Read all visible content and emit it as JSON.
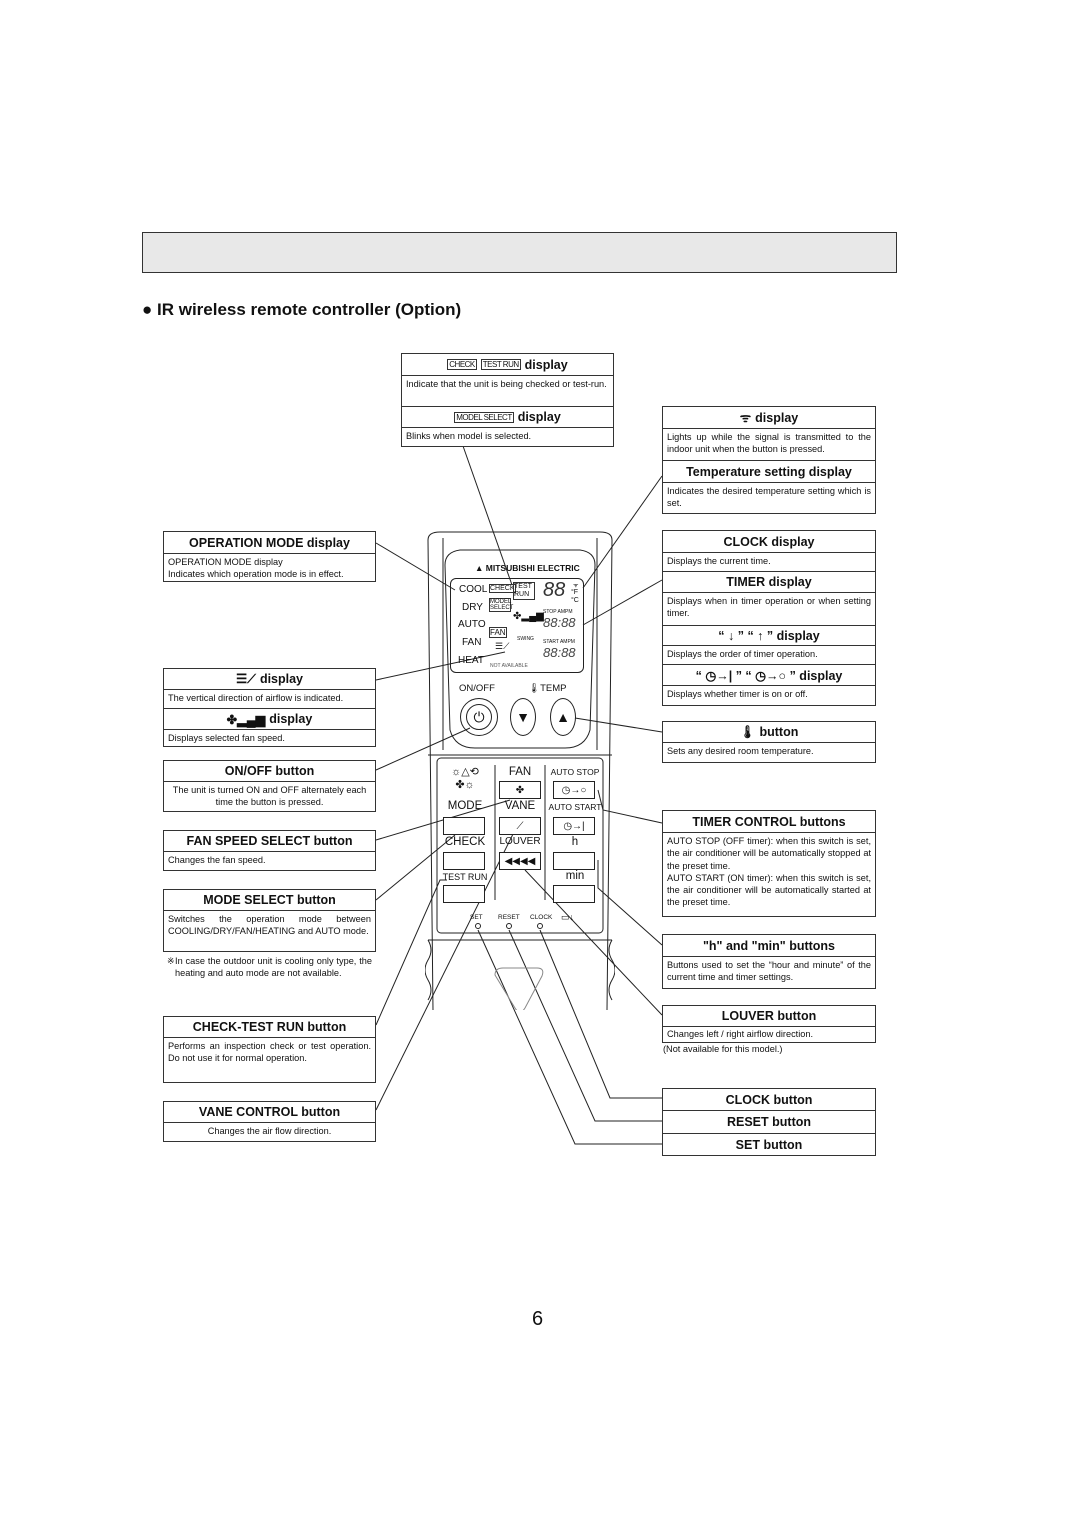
{
  "page": {
    "title": "● IR wireless remote controller (Option)",
    "page_number": "6"
  },
  "callouts": {
    "check_display": {
      "tag1": "CHECK",
      "tag2": "TEST RUN",
      "title": "display",
      "desc": "Indicate that the unit is being checked or test-run."
    },
    "model_select_display": {
      "tag": "MODEL SELECT",
      "title": "display",
      "desc": "Blinks when model is selected."
    },
    "signal_display": {
      "icon": "signal-icon",
      "title": "display",
      "desc": "Lights up while the signal is transmitted to the indoor unit when the button is pressed."
    },
    "temp_setting_display": {
      "title": "Temperature setting display",
      "desc": "Indicates the desired temperature setting which is set."
    },
    "operation_mode_display": {
      "title": "OPERATION MODE display",
      "desc1": "OPERATION MODE display",
      "desc2": "Indicates which operation mode is in effect."
    },
    "vane_display": {
      "icon": "vane-airflow-icon",
      "title": "display",
      "desc": "The vertical direction of airflow is indicated."
    },
    "fan_speed_display": {
      "icon": "fan-speed-icon",
      "title": "display",
      "desc": "Displays selected fan speed."
    },
    "onoff_button": {
      "title": "ON/OFF button",
      "desc": "The unit is turned ON and OFF alternately each time the button is pressed."
    },
    "fan_speed_button": {
      "title": "FAN SPEED SELECT button",
      "desc": "Changes the fan speed."
    },
    "mode_select_button": {
      "title": "MODE SELECT button",
      "desc": "Switches the operation mode between COOLING/DRY/FAN/HEATING and AUTO mode.",
      "note": "※In case the outdoor unit is cooling only type, the heating and auto mode are not available."
    },
    "check_test_run_button": {
      "title": "CHECK-TEST RUN button",
      "desc": "Performs an inspection  check or test operation. Do not use it for normal operation."
    },
    "vane_control_button": {
      "title": "VANE CONTROL button",
      "desc": "Changes the air flow direction."
    },
    "clock_display": {
      "title": "CLOCK display",
      "desc": "Displays the current time."
    },
    "timer_display": {
      "title": "TIMER display",
      "desc": "Displays when in timer operation or when setting timer."
    },
    "order_display": {
      "title": "“ ↓ ” “ ↑ ” display",
      "desc": "Displays the order of timer operation."
    },
    "timer_onoff_display": {
      "title": "“ ◷→| ” “ ◷→○ ” display",
      "desc": "Displays whether timer is on or off."
    },
    "temp_button": {
      "icon": "thermometer-icon",
      "title": "button",
      "desc": "Sets any desired room temperature."
    },
    "timer_control_buttons": {
      "title": "TIMER CONTROL buttons",
      "desc1": "AUTO STOP (OFF timer):  when this switch is set, the air conditioner will be automatically stopped at the preset time.",
      "desc2": "AUTO START (ON timer): when this switch is set, the air conditioner will be automatically started at the preset time."
    },
    "h_min_buttons": {
      "title": "\"h\" and \"min\" buttons",
      "desc": "Buttons used to set the “hour and minute” of the current time and timer settings."
    },
    "louver_button": {
      "title": "LOUVER button",
      "desc": "Changes left / right airflow direction.",
      "note": "(Not available for this model.)"
    },
    "clock_button": {
      "title": "CLOCK button"
    },
    "reset_button": {
      "title": "RESET button"
    },
    "set_button": {
      "title": "SET button"
    }
  },
  "remote": {
    "brand": "MITSUBISHI ELECTRIC",
    "modes": [
      "COOL",
      "DRY",
      "AUTO",
      "FAN",
      "HEAT"
    ],
    "lcd_check": "CHECK",
    "lcd_test_run": "TEST RUN",
    "lcd_model_select": "MODEL SELECT",
    "lcd_fan": "FAN",
    "lcd_temp": "88",
    "lcd_unit_f": "°F",
    "lcd_unit_c": "°C",
    "lcd_stop": "STOP AMPM",
    "lcd_start": "START AMPM",
    "lcd_time": "88:88",
    "lcd_swing": "SWING",
    "lcd_not_available": "NOT AVAILABLE",
    "onoff_label": "ON/OFF",
    "temp_label": "TEMP",
    "fan": "FAN",
    "mode": "MODE",
    "vane": "VANE",
    "check": "CHECK",
    "louver": "LOUVER",
    "test_run": "TEST RUN",
    "auto_stop": "AUTO STOP",
    "auto_start": "AUTO START",
    "h": "h",
    "min": "min",
    "set": "SET",
    "reset": "RESET",
    "clock": "CLOCK"
  }
}
